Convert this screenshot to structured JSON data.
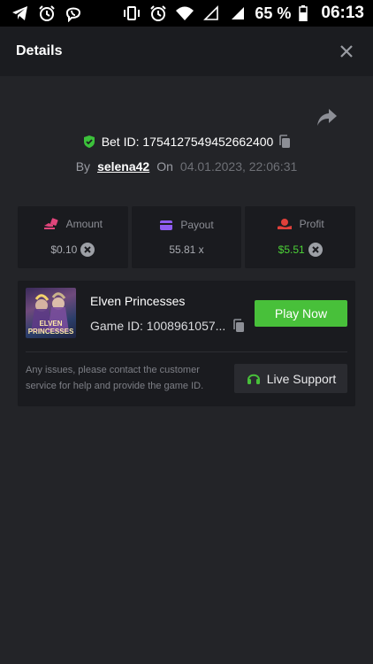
{
  "status_bar": {
    "battery_percent": "65 %",
    "time": "06:13",
    "left_icons": [
      "telegram-icon",
      "alarm-icon",
      "viber-icon"
    ],
    "right_icons": [
      "vibrate-icon",
      "alarm-icon",
      "wifi-icon",
      "signal-empty-icon",
      "signal-icon",
      "battery-icon"
    ]
  },
  "header": {
    "title": "Details"
  },
  "bet": {
    "id_label": "Bet ID: 1754127549452662400",
    "by_label": "By",
    "user": "selena42",
    "on_label": "On",
    "date": "04.01.2023, 22:06:31"
  },
  "stats": {
    "amount": {
      "label": "Amount",
      "value": "$0.10"
    },
    "payout": {
      "label": "Payout",
      "value": "55.81 x"
    },
    "profit": {
      "label": "Profit",
      "value": "$5.51"
    }
  },
  "game": {
    "thumb_text": "ELVEN PRINCESSES",
    "name": "Elven Princesses",
    "id_label": "Game ID: 1008961057...",
    "play_label": "Play Now",
    "support_text": "Any issues, please contact the customer service for help and provide the game ID.",
    "support_label": "Live Support"
  },
  "colors": {
    "accent_green": "#48c03a",
    "profit_green": "#4cd137",
    "amount_pink": "#e0457b",
    "payout_purple": "#8e5cf0",
    "profit_red": "#e0403a"
  }
}
